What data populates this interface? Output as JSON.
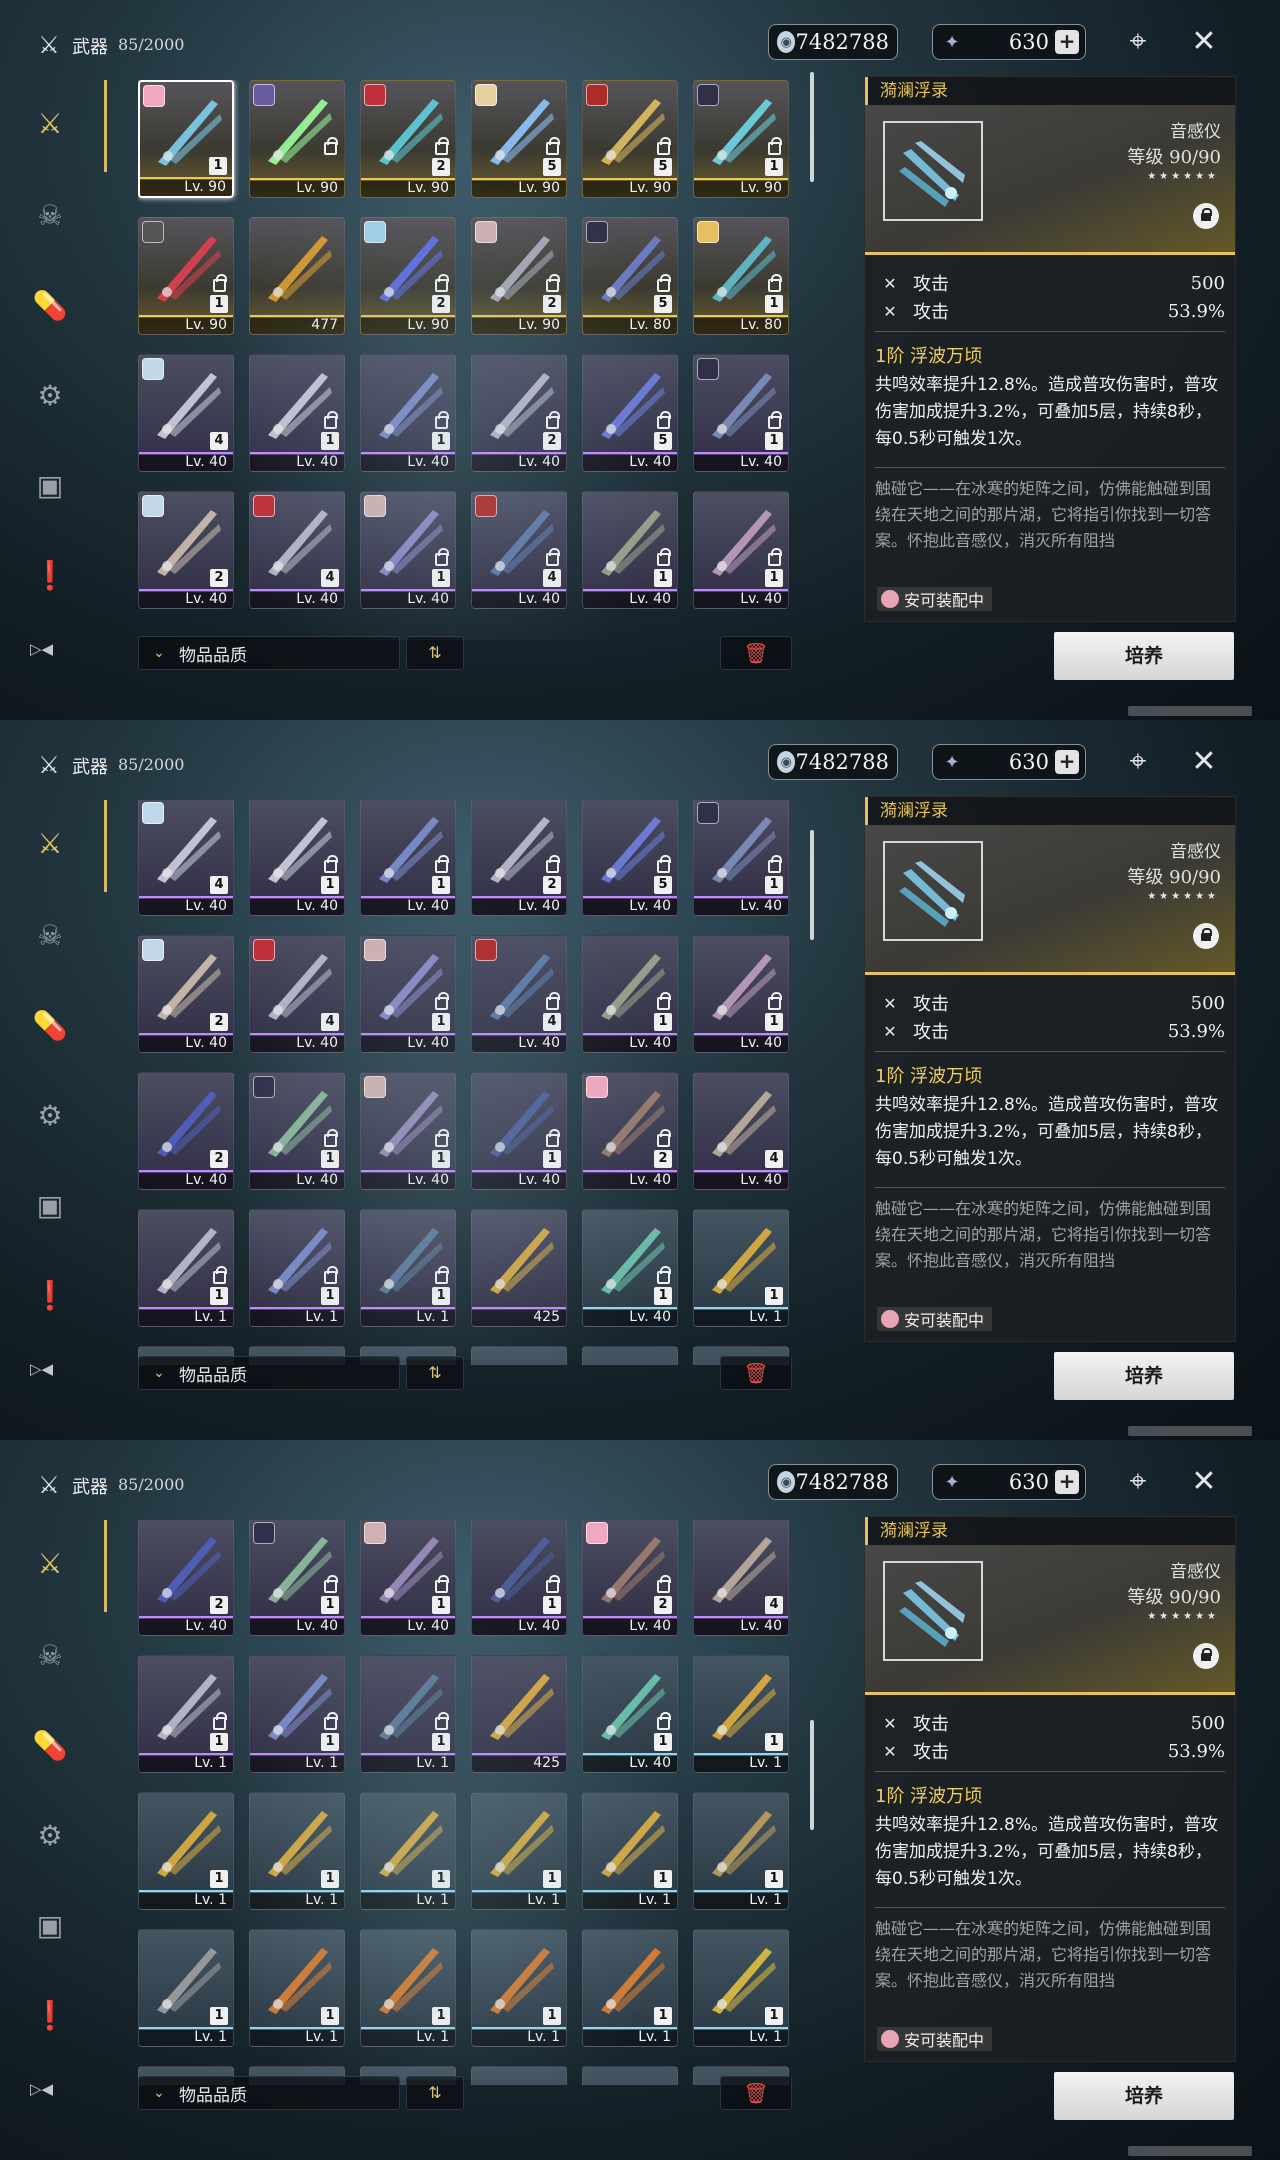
{
  "header": {
    "category_icon": "crossed-swords-icon",
    "title": "武器",
    "count": "85/2000",
    "currency1": "7482788",
    "currency2": "630",
    "plus": "+"
  },
  "sidebar": [
    {
      "icon": "crossed-swords-icon",
      "active": true
    },
    {
      "icon": "demon-mask-icon",
      "active": false
    },
    {
      "icon": "capsule-icon",
      "active": false
    },
    {
      "icon": "radio-device-icon",
      "active": false
    },
    {
      "icon": "chest-icon",
      "active": false
    },
    {
      "icon": "exclamation-icon",
      "active": false
    }
  ],
  "sort": {
    "label": "物品品质",
    "chevron": "⌄",
    "order": "⇅",
    "trash": "🗑"
  },
  "detail": {
    "title": "漪澜浮录",
    "type": "音感仪",
    "level_label": "等级",
    "level_value": "90/90",
    "stars": "★★★★★★",
    "stat1_name": "攻击",
    "stat1_value": "500",
    "stat2_name": "攻击",
    "stat2_value": "53.9%",
    "skill_title": "1阶 浮波万顷",
    "skill_text": "共鸣效率提升12.8%。造成普攻伤害时，普攻伤害加成提升3.2%，可叠加5层，持续8秒，每0.5秒可触发1次。",
    "lore": "触碰它——在冰寒的矩阵之间，仿佛能触碰到围绕在天地之间的那片湖，它将指引你找到一切答案。怀抱此音感仪，消灭所有阻挡",
    "equipped": "安可装配中",
    "cultivate": "培养"
  },
  "panels": [
    {
      "rows": [
        [
          {
            "lv": "Lv. 90",
            "rank": "1",
            "q": "q5",
            "avatar": "#f2a7c0",
            "sel": true,
            "lock": false,
            "hue": "#7fd0f0"
          },
          {
            "lv": "Lv. 90",
            "rank": "",
            "q": "q5",
            "avatar": "#6a5aa0",
            "lock": true,
            "hue": "#9dff9d"
          },
          {
            "lv": "Lv. 90",
            "rank": "2",
            "q": "q5",
            "avatar": "#c0303a",
            "lock": true,
            "hue": "#5fd0e0"
          },
          {
            "lv": "Lv. 90",
            "rank": "5",
            "q": "q5",
            "avatar": "#e6d0a0",
            "lock": true,
            "hue": "#8fc8ff"
          },
          {
            "lv": "Lv. 90",
            "rank": "5",
            "q": "q5",
            "avatar": "#b02a2a",
            "lock": true,
            "hue": "#e0c060"
          },
          {
            "lv": "Lv. 90",
            "rank": "1",
            "q": "q5",
            "avatar": "#30304a",
            "lock": true,
            "hue": "#6fd8e8"
          }
        ],
        [
          {
            "lv": "Lv. 90",
            "rank": "1",
            "q": "q5",
            "avatar": "#555",
            "lock": true,
            "hue": "#e04050"
          },
          {
            "lv": "477",
            "rank": "",
            "q": "q5",
            "avatar": "",
            "lock": false,
            "hue": "#e0a030"
          },
          {
            "lv": "Lv. 90",
            "rank": "2",
            "q": "q5",
            "avatar": "#9fd0e8",
            "lock": true,
            "hue": "#6070f0"
          },
          {
            "lv": "Lv. 90",
            "rank": "2",
            "q": "q5",
            "avatar": "#d0b0b0",
            "lock": true,
            "hue": "#b0b0c0"
          },
          {
            "lv": "Lv. 80",
            "rank": "5",
            "q": "q5",
            "avatar": "#30304a",
            "lock": true,
            "hue": "#7080d0"
          },
          {
            "lv": "Lv. 80",
            "rank": "1",
            "q": "q5",
            "avatar": "#e6c060",
            "lock": true,
            "hue": "#60c0d0"
          }
        ],
        [
          {
            "lv": "Lv. 40",
            "rank": "4",
            "q": "q4",
            "avatar": "#c0d8e8",
            "lock": false,
            "hue": "#d0d0e0"
          },
          {
            "lv": "Lv. 40",
            "rank": "1",
            "q": "q4",
            "avatar": "",
            "lock": true,
            "hue": "#d0d0e0"
          },
          {
            "lv": "Lv. 40",
            "rank": "1",
            "q": "q4",
            "avatar": "",
            "lock": true,
            "hue": "#8090d0"
          },
          {
            "lv": "Lv. 40",
            "rank": "2",
            "q": "q4",
            "avatar": "",
            "lock": true,
            "hue": "#c0c0d0"
          },
          {
            "lv": "Lv. 40",
            "rank": "5",
            "q": "q4",
            "avatar": "",
            "lock": true,
            "hue": "#7080e0"
          },
          {
            "lv": "Lv. 40",
            "rank": "1",
            "q": "q4",
            "avatar": "#30304a",
            "lock": true,
            "hue": "#8090c0"
          }
        ],
        [
          {
            "lv": "Lv. 40",
            "rank": "2",
            "q": "q4",
            "avatar": "#c0d8e8",
            "lock": false,
            "hue": "#d0c0b0"
          },
          {
            "lv": "Lv. 40",
            "rank": "4",
            "q": "q4",
            "avatar": "#c0303a",
            "lock": false,
            "hue": "#c0c0d0"
          },
          {
            "lv": "Lv. 40",
            "rank": "1",
            "q": "q4",
            "avatar": "#d0b0b0",
            "lock": true,
            "hue": "#9090d0"
          },
          {
            "lv": "Lv. 40",
            "rank": "4",
            "q": "q4",
            "avatar": "#b02a2a",
            "lock": true,
            "hue": "#6080b0"
          },
          {
            "lv": "Lv. 40",
            "rank": "1",
            "q": "q4",
            "avatar": "",
            "lock": true,
            "hue": "#a0a890"
          },
          {
            "lv": "Lv. 40",
            "rank": "1",
            "q": "q4",
            "avatar": "",
            "lock": true,
            "hue": "#c0a0c0"
          }
        ]
      ]
    },
    {
      "rows": [
        [
          {
            "lv": "Lv. 40",
            "rank": "4",
            "q": "q4",
            "avatar": "#c0d8e8",
            "lock": false,
            "hue": "#d0d0e0"
          },
          {
            "lv": "Lv. 40",
            "rank": "1",
            "q": "q4",
            "avatar": "",
            "lock": true,
            "hue": "#d0d0e0"
          },
          {
            "lv": "Lv. 40",
            "rank": "1",
            "q": "q4",
            "avatar": "",
            "lock": true,
            "hue": "#8090d0"
          },
          {
            "lv": "Lv. 40",
            "rank": "2",
            "q": "q4",
            "avatar": "",
            "lock": true,
            "hue": "#c0c0d0"
          },
          {
            "lv": "Lv. 40",
            "rank": "5",
            "q": "q4",
            "avatar": "",
            "lock": true,
            "hue": "#7080e0"
          },
          {
            "lv": "Lv. 40",
            "rank": "1",
            "q": "q4",
            "avatar": "#30304a",
            "lock": true,
            "hue": "#8090c0"
          }
        ],
        [
          {
            "lv": "Lv. 40",
            "rank": "2",
            "q": "q4",
            "avatar": "#c0d8e8",
            "lock": false,
            "hue": "#d0c0b0"
          },
          {
            "lv": "Lv. 40",
            "rank": "4",
            "q": "q4",
            "avatar": "#c0303a",
            "lock": false,
            "hue": "#c0c0d0"
          },
          {
            "lv": "Lv. 40",
            "rank": "1",
            "q": "q4",
            "avatar": "#d0b0b0",
            "lock": true,
            "hue": "#9090d0"
          },
          {
            "lv": "Lv. 40",
            "rank": "4",
            "q": "q4",
            "avatar": "#b02a2a",
            "lock": true,
            "hue": "#6080b0"
          },
          {
            "lv": "Lv. 40",
            "rank": "1",
            "q": "q4",
            "avatar": "",
            "lock": true,
            "hue": "#a0a890"
          },
          {
            "lv": "Lv. 40",
            "rank": "1",
            "q": "q4",
            "avatar": "",
            "lock": true,
            "hue": "#c0a0c0"
          }
        ],
        [
          {
            "lv": "Lv. 40",
            "rank": "2",
            "q": "q4",
            "avatar": "",
            "lock": false,
            "hue": "#5060c0"
          },
          {
            "lv": "Lv. 40",
            "rank": "1",
            "q": "q4",
            "avatar": "#30304a",
            "lock": true,
            "hue": "#90c0a0"
          },
          {
            "lv": "Lv. 40",
            "rank": "1",
            "q": "q4",
            "avatar": "#d0b0b0",
            "lock": true,
            "hue": "#a090c0"
          },
          {
            "lv": "Lv. 40",
            "rank": "1",
            "q": "q4",
            "avatar": "",
            "lock": true,
            "hue": "#5060a0"
          },
          {
            "lv": "Lv. 40",
            "rank": "2",
            "q": "q4",
            "avatar": "#f2a7c0",
            "lock": true,
            "hue": "#a08070"
          },
          {
            "lv": "Lv. 40",
            "rank": "4",
            "q": "q4",
            "avatar": "",
            "lock": false,
            "hue": "#c0b0a0"
          }
        ],
        [
          {
            "lv": "Lv. 1",
            "rank": "1",
            "q": "q4",
            "avatar": "",
            "lock": true,
            "hue": "#c0c0d0"
          },
          {
            "lv": "Lv. 1",
            "rank": "1",
            "q": "q4",
            "avatar": "",
            "lock": true,
            "hue": "#8090d0"
          },
          {
            "lv": "Lv. 1",
            "rank": "1",
            "q": "q4",
            "avatar": "",
            "lock": true,
            "hue": "#6080a0"
          },
          {
            "lv": "425",
            "rank": "",
            "q": "q4",
            "avatar": "",
            "lock": false,
            "hue": "#e0b040"
          },
          {
            "lv": "Lv. 40",
            "rank": "1",
            "q": "q3",
            "avatar": "",
            "lock": true,
            "hue": "#70c8b0"
          },
          {
            "lv": "Lv. 1",
            "rank": "1",
            "q": "q3",
            "avatar": "",
            "lock": false,
            "hue": "#e0b040"
          }
        ]
      ]
    },
    {
      "rows": [
        [
          {
            "lv": "Lv. 40",
            "rank": "2",
            "q": "q4",
            "avatar": "",
            "lock": false,
            "hue": "#5060c0"
          },
          {
            "lv": "Lv. 40",
            "rank": "1",
            "q": "q4",
            "avatar": "#30304a",
            "lock": true,
            "hue": "#90c0a0"
          },
          {
            "lv": "Lv. 40",
            "rank": "1",
            "q": "q4",
            "avatar": "#d0b0b0",
            "lock": true,
            "hue": "#a090c0"
          },
          {
            "lv": "Lv. 40",
            "rank": "1",
            "q": "q4",
            "avatar": "",
            "lock": true,
            "hue": "#5060a0"
          },
          {
            "lv": "Lv. 40",
            "rank": "2",
            "q": "q4",
            "avatar": "#f2a7c0",
            "lock": true,
            "hue": "#a08070"
          },
          {
            "lv": "Lv. 40",
            "rank": "4",
            "q": "q4",
            "avatar": "",
            "lock": false,
            "hue": "#c0b0a0"
          }
        ],
        [
          {
            "lv": "Lv. 1",
            "rank": "1",
            "q": "q4",
            "avatar": "",
            "lock": true,
            "hue": "#c0c0d0"
          },
          {
            "lv": "Lv. 1",
            "rank": "1",
            "q": "q4",
            "avatar": "",
            "lock": true,
            "hue": "#8090d0"
          },
          {
            "lv": "Lv. 1",
            "rank": "1",
            "q": "q4",
            "avatar": "",
            "lock": true,
            "hue": "#6080a0"
          },
          {
            "lv": "425",
            "rank": "",
            "q": "q4",
            "avatar": "",
            "lock": false,
            "hue": "#e0b040"
          },
          {
            "lv": "Lv. 40",
            "rank": "1",
            "q": "q3",
            "avatar": "",
            "lock": true,
            "hue": "#70c8b0"
          },
          {
            "lv": "Lv. 1",
            "rank": "1",
            "q": "q3",
            "avatar": "",
            "lock": false,
            "hue": "#e0b040"
          }
        ],
        [
          {
            "lv": "Lv. 1",
            "rank": "1",
            "q": "q3",
            "avatar": "",
            "lock": false,
            "hue": "#e0b040"
          },
          {
            "lv": "Lv. 1",
            "rank": "1",
            "q": "q3",
            "avatar": "",
            "lock": false,
            "hue": "#e0b040"
          },
          {
            "lv": "Lv. 1",
            "rank": "1",
            "q": "q3",
            "avatar": "",
            "lock": false,
            "hue": "#e0b040"
          },
          {
            "lv": "Lv. 1",
            "rank": "1",
            "q": "q3",
            "avatar": "",
            "lock": false,
            "hue": "#e0b040"
          },
          {
            "lv": "Lv. 1",
            "rank": "1",
            "q": "q3",
            "avatar": "",
            "lock": false,
            "hue": "#e0b040"
          },
          {
            "lv": "Lv. 1",
            "rank": "1",
            "q": "q3",
            "avatar": "",
            "lock": false,
            "hue": "#c0a060"
          }
        ],
        [
          {
            "lv": "Lv. 1",
            "rank": "1",
            "q": "q3",
            "avatar": "",
            "lock": false,
            "hue": "#a0a0a0"
          },
          {
            "lv": "Lv. 1",
            "rank": "1",
            "q": "q3",
            "avatar": "",
            "lock": false,
            "hue": "#e08030"
          },
          {
            "lv": "Lv. 1",
            "rank": "1",
            "q": "q3",
            "avatar": "",
            "lock": false,
            "hue": "#e08030"
          },
          {
            "lv": "Lv. 1",
            "rank": "1",
            "q": "q3",
            "avatar": "",
            "lock": false,
            "hue": "#e08030"
          },
          {
            "lv": "Lv. 1",
            "rank": "1",
            "q": "q3",
            "avatar": "",
            "lock": false,
            "hue": "#e08030"
          },
          {
            "lv": "Lv. 1",
            "rank": "1",
            "q": "q3",
            "avatar": "",
            "lock": false,
            "hue": "#e0c040"
          }
        ]
      ]
    }
  ]
}
